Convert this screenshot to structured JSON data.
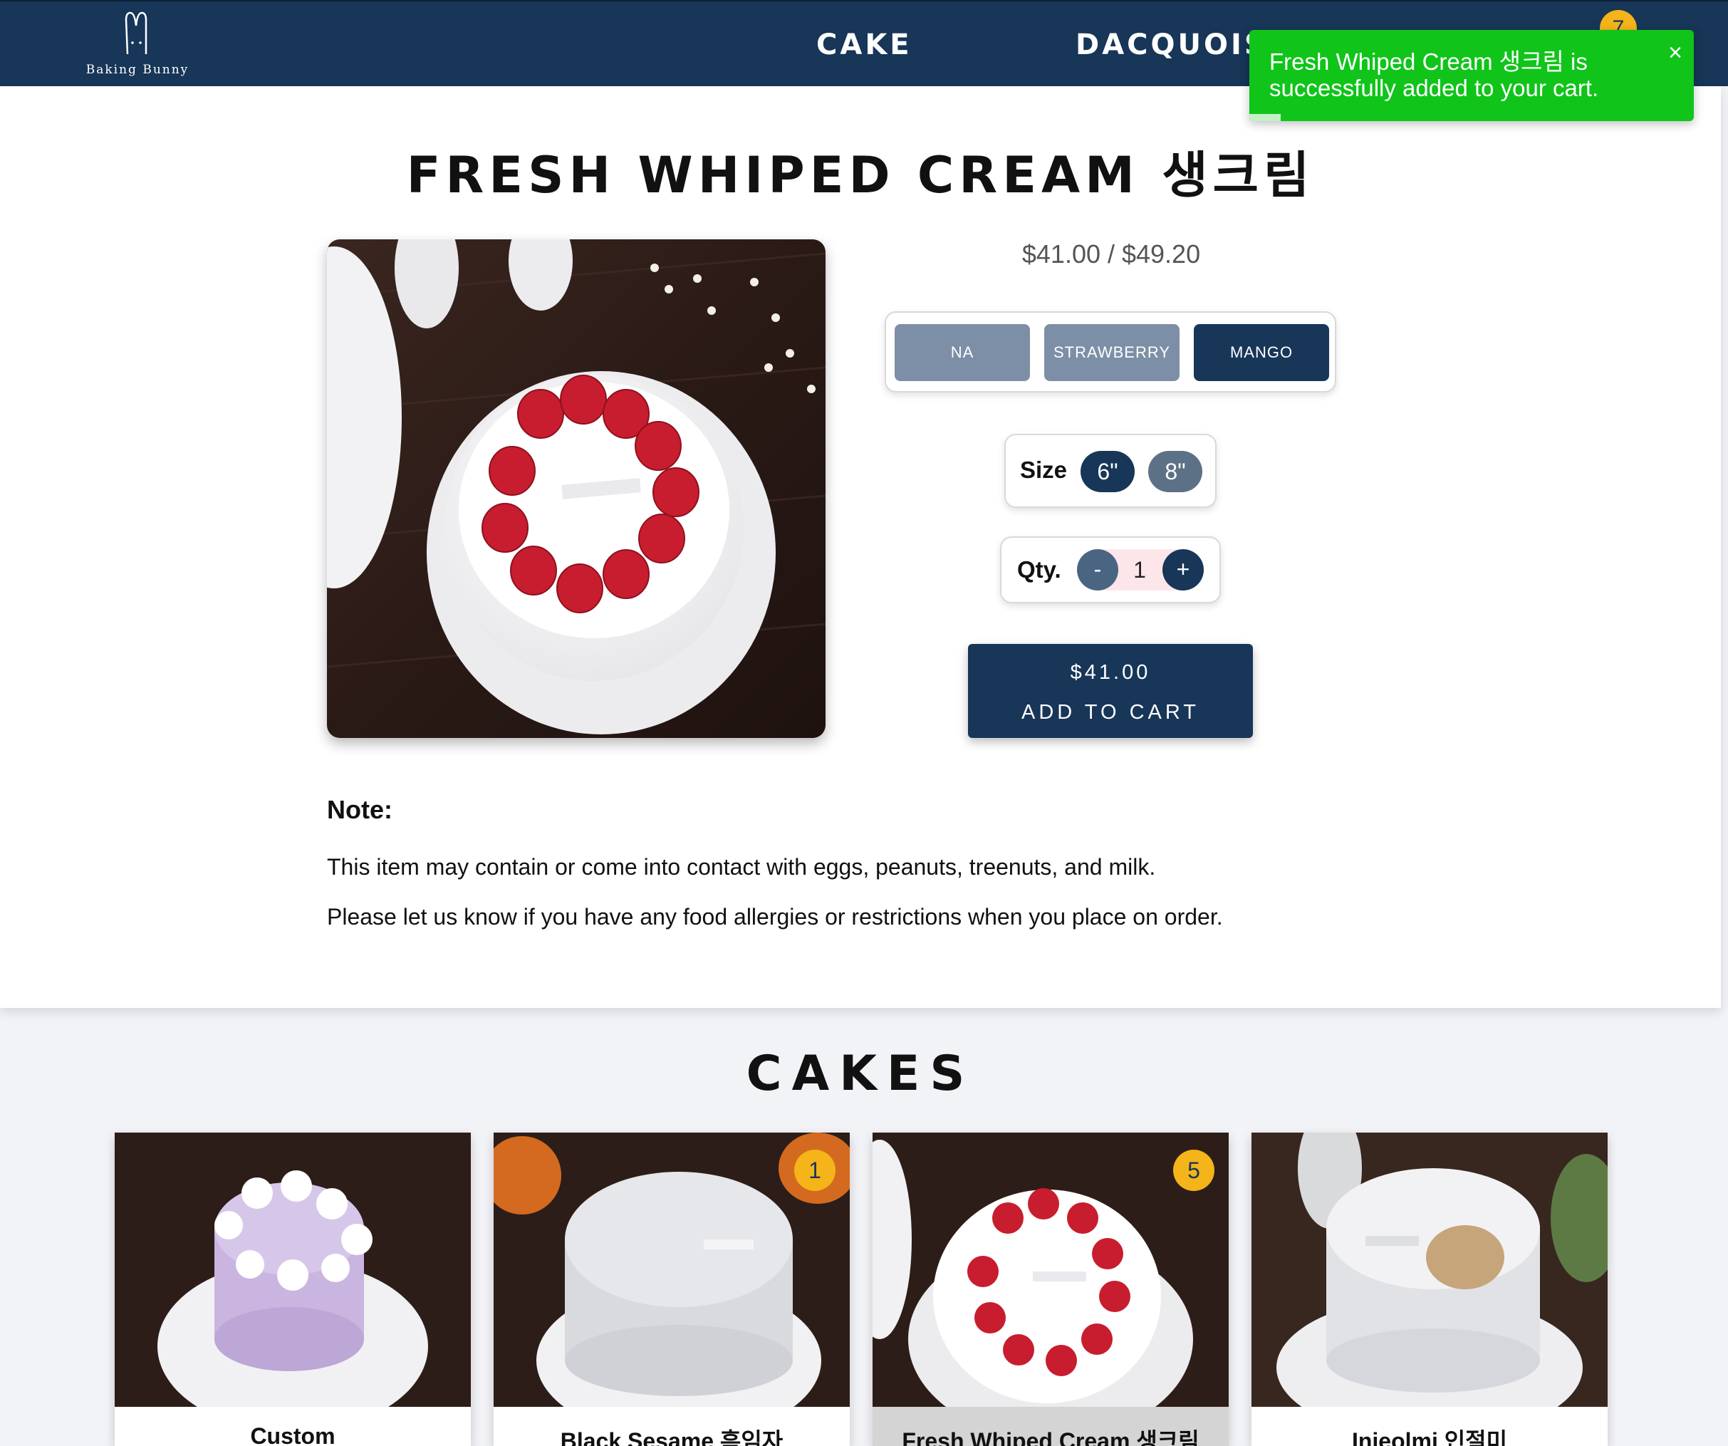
{
  "header": {
    "logo_text": "Baking Bunny",
    "nav": {
      "cake": "CAKE",
      "dacquoise": "DACQUOISE"
    },
    "cart_count": "7"
  },
  "toast": {
    "message": "Fresh Whiped Cream 생크림 is successfully added to your cart.",
    "close_label": "×",
    "progress_fraction": 0.07
  },
  "product": {
    "title": "FRESH WHIPED CREAM 생크림",
    "price_range": "$41.00 / $49.20",
    "flavors": [
      "NA",
      "STRAWBERRY",
      "MANGO"
    ],
    "selected_flavor": "MANGO",
    "size_label": "Size",
    "sizes": [
      "6\"",
      "8\""
    ],
    "selected_size": "6\"",
    "qty_label": "Qty.",
    "qty_minus": "-",
    "qty_value": "1",
    "qty_plus": "+",
    "add_price": "$41.00",
    "add_label": "ADD TO CART"
  },
  "note": {
    "heading": "Note:",
    "line1": "This item may contain or come into contact with eggs, peanuts, treenuts, and milk.",
    "line2": "Please let us know if you have any food allergies or restrictions when you place on order."
  },
  "cakes": {
    "title": "CAKES",
    "cards": [
      {
        "name": "Custom",
        "badge": ""
      },
      {
        "name": "Black Sesame 흑임자",
        "badge": "1"
      },
      {
        "name": "Fresh Whiped Cream 생크림",
        "badge": "5"
      },
      {
        "name": "Injeolmi 인절미",
        "badge": ""
      }
    ]
  },
  "colors": {
    "navy": "#173658",
    "toast_green": "#10c41a",
    "badge_yellow": "#f4b41a",
    "flavor_inactive": "#7d8fa6"
  }
}
